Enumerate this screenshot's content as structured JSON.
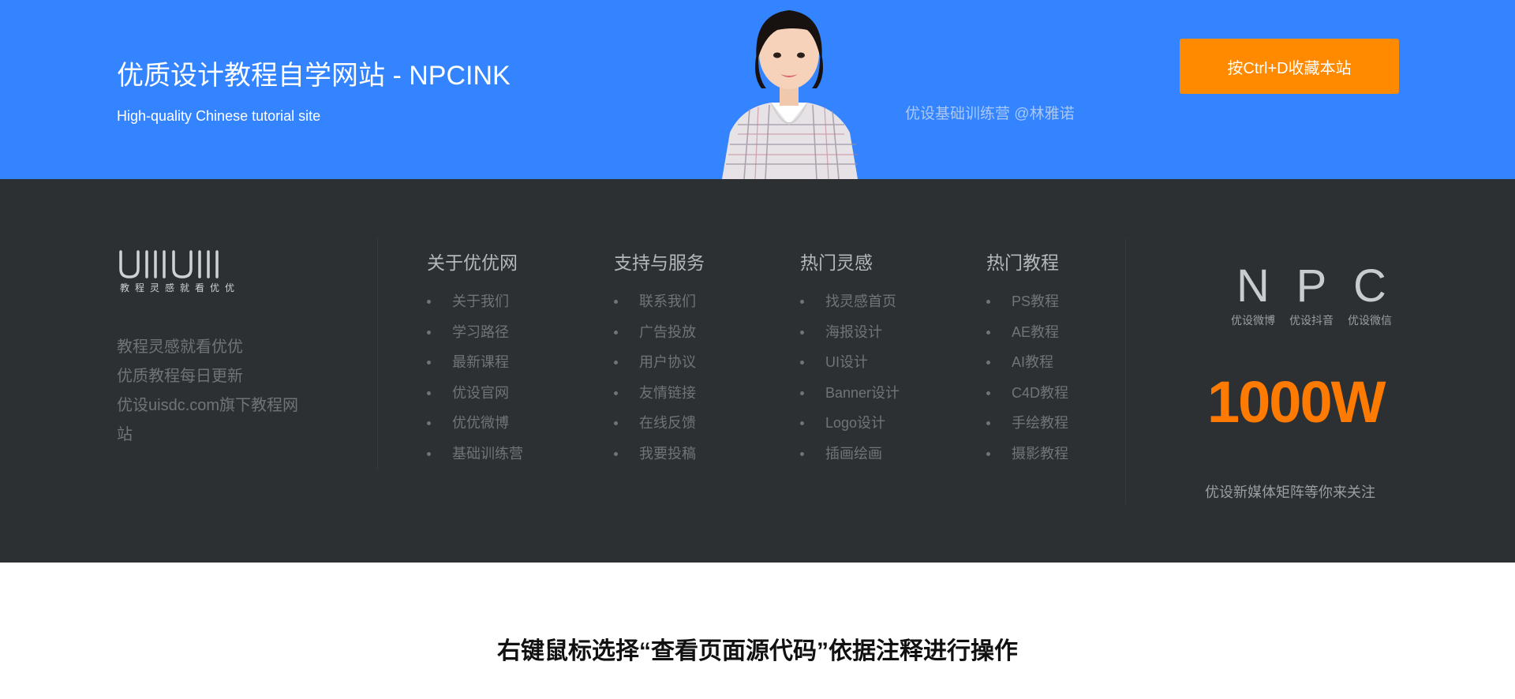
{
  "banner": {
    "title": "优质设计教程自学网站 - NPCINK",
    "subtitle": "High-quality Chinese tutorial site",
    "caption": "优设基础训练营 @林雅诺",
    "bookmark_button": "按Ctrl+D收藏本站"
  },
  "footer": {
    "logo": {
      "text": "UIIIUIII",
      "slogan": "教程灵感就看优优"
    },
    "about_lines": [
      "教程灵感就看优优",
      "优质教程每日更新",
      "优设uisdc.com旗下教程网站"
    ],
    "columns": [
      {
        "title": "关于优优网",
        "items": [
          "关于我们",
          "学习路径",
          "最新课程",
          "优设官网",
          "优优微博",
          "基础训练营"
        ]
      },
      {
        "title": "支持与服务",
        "items": [
          "联系我们",
          "广告投放",
          "用户协议",
          "友情链接",
          "在线反馈",
          "我要投稿"
        ]
      },
      {
        "title": "热门灵感",
        "items": [
          "找灵感首页",
          "海报设计",
          "UI设计",
          "Banner设计",
          "Logo设计",
          "插画绘画"
        ]
      },
      {
        "title": "热门教程",
        "items": [
          "PS教程",
          "AE教程",
          "AI教程",
          "C4D教程",
          "手绘教程",
          "摄影教程"
        ]
      }
    ],
    "social": [
      {
        "letter": "N",
        "label": "优设微博"
      },
      {
        "letter": "P",
        "label": "优设抖音"
      },
      {
        "letter": "C",
        "label": "优设微信"
      }
    ],
    "big_number": "1000W",
    "follow_text": "优设新媒体矩阵等你来关注"
  },
  "page_note": "右键鼠标选择“查看页面源代码”依据注释进行操作",
  "colors": {
    "banner_bg": "#3384fe",
    "accent_orange": "#ff8a00",
    "footer_bg": "#2d3033"
  }
}
